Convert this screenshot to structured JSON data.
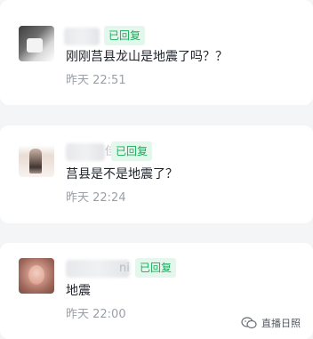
{
  "comments": [
    {
      "name_suffix": "",
      "badge": "已回复",
      "message": "刚刚莒县龙山是地震了吗？？",
      "time": "昨天 22:51"
    },
    {
      "name_suffix": "佳",
      "badge": "已回复",
      "message": "莒县是不是地震了？",
      "time": "昨天 22:24"
    },
    {
      "name_suffix": "ni",
      "badge": "已回复",
      "message": "地震",
      "time": "昨天 22:00"
    }
  ],
  "watermark": {
    "icon": "wechat-official-account-icon",
    "text": "直播日照"
  },
  "colors": {
    "badge_text": "#1aad5a",
    "badge_bg": "#e4f7ec",
    "page_bg": "#f4f5f7",
    "card_bg": "#ffffff",
    "time_text": "#9aa0a8"
  }
}
